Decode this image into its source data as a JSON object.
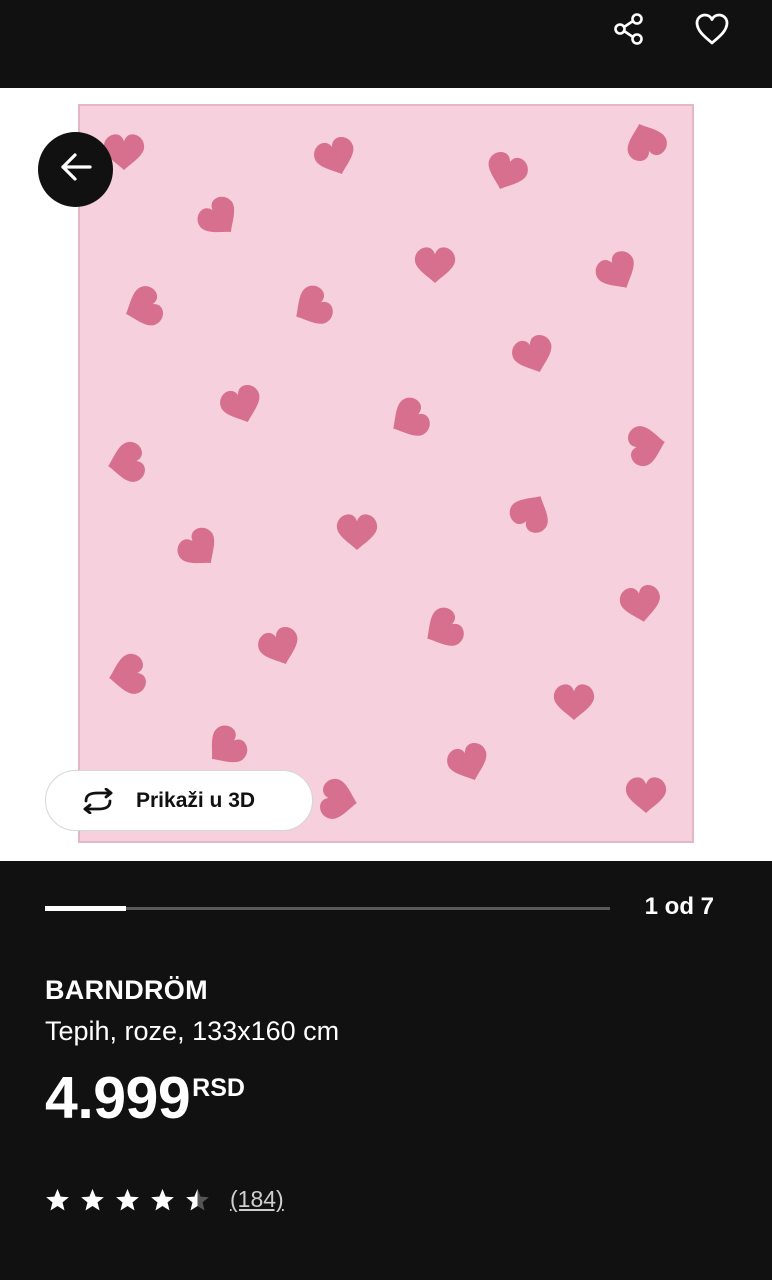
{
  "header": {
    "share_icon": "share-icon",
    "favorite_icon": "heart-icon",
    "back_icon": "arrow-left-icon"
  },
  "gallery": {
    "view_3d_label": "Prikaži u 3D",
    "view_3d_icon": "rotate-arrows-icon",
    "counter": "1 od 7",
    "current_image": 1,
    "total_images": 7,
    "rug_color": "#f6d0dc",
    "heart_color": "#d76f8f"
  },
  "product": {
    "name": "BARNDRÖM",
    "description": "Tepih, roze, 133x160 cm",
    "price": "4.999",
    "currency": "RSD",
    "rating": 4.5,
    "rating_max": 5,
    "review_count": "(184)"
  },
  "colors": {
    "background": "#111111",
    "text": "#ffffff"
  }
}
